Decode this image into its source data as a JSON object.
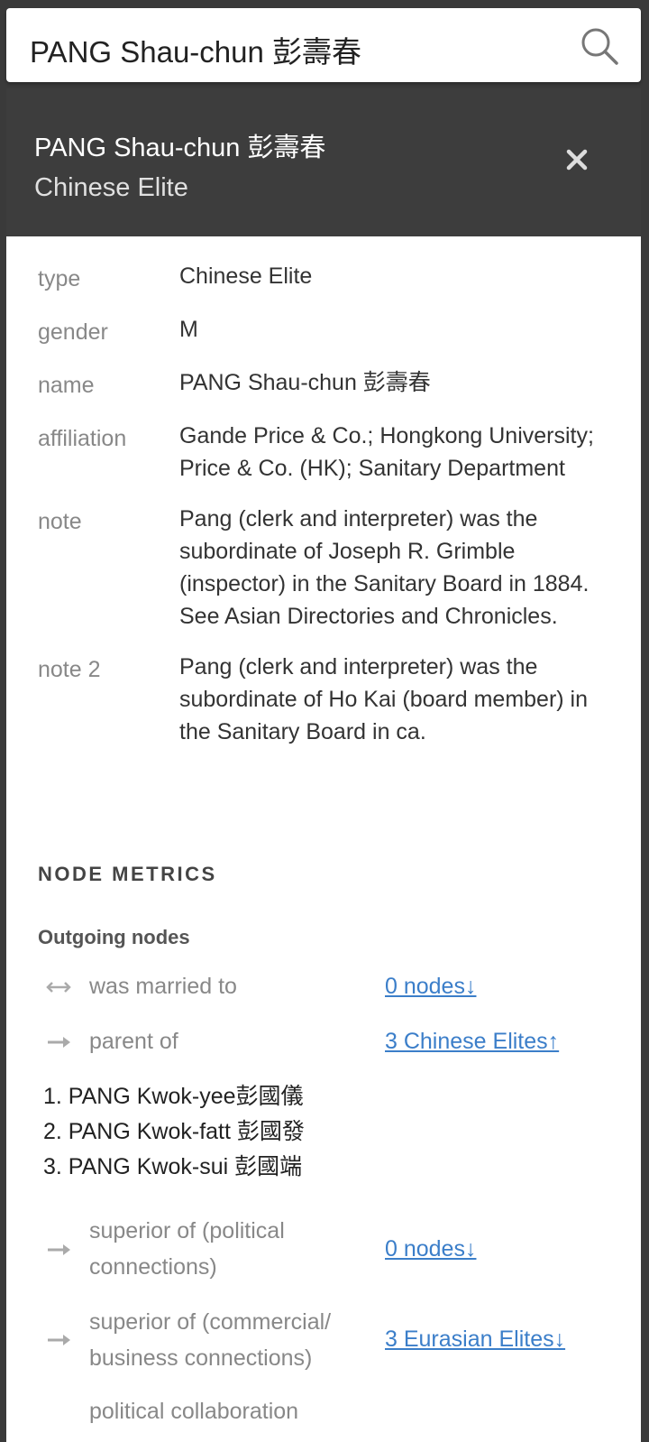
{
  "search": {
    "value": "PANG Shau-chun 彭壽春"
  },
  "header": {
    "title": "PANG Shau-chun 彭壽春",
    "subtitle": "Chinese Elite"
  },
  "attributes": [
    {
      "key": "type",
      "value": "Chinese Elite"
    },
    {
      "key": "gender",
      "value": "M"
    },
    {
      "key": "name",
      "value": "PANG Shau-chun 彭壽春"
    },
    {
      "key": "affiliation",
      "value": "Gande Price & Co.; Hongkong University; Price & Co. (HK); Sanitary Department"
    },
    {
      "key": "note",
      "value": "Pang (clerk and interpreter) was the subordinate of Joseph R. Grimble (inspector) in the Sanitary Board in 1884. See Asian Directories and Chronicles."
    },
    {
      "key": "note 2",
      "value": "Pang (clerk and interpreter) was the subordinate of Ho Kai (board member) in the Sanitary Board in ca."
    }
  ],
  "metrics": {
    "title": "NODE METRICS",
    "outgoing_label": "Outgoing nodes",
    "relations": [
      {
        "icon": "double-arrow-icon",
        "label": "was married to",
        "link": "0 nodes↓"
      },
      {
        "icon": "right-arrow-icon",
        "label": "parent of",
        "link": "3 Chinese Elites↑"
      },
      {
        "icon": "right-arrow-icon",
        "label": "superior of (political connections)",
        "link": "0 nodes↓"
      },
      {
        "icon": "right-arrow-icon",
        "label": "superior of (commercial/ business connections)",
        "link": "3 Eurasian Elites↓"
      },
      {
        "icon": "right-arrow-icon",
        "label": "political collaboration",
        "link": ""
      }
    ],
    "children": [
      "1. PANG Kwok-yee彭國儀",
      "2. PANG Kwok-fatt 彭國發",
      "3. PANG Kwok-sui 彭國端"
    ]
  },
  "colors": {
    "header_bg": "#3d3d3d",
    "link": "#3b7ec9",
    "label_gray": "#888888"
  }
}
